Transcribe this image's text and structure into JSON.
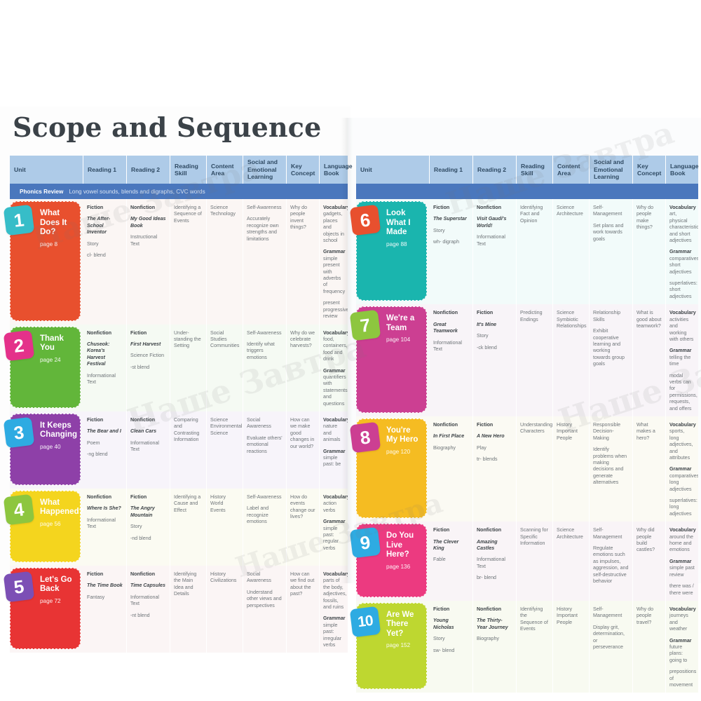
{
  "document": {
    "title": "Scope and Sequence",
    "watermark": "Наше Завтра"
  },
  "table": {
    "columns": [
      "Unit",
      "Reading 1",
      "Reading 2",
      "Reading Skill",
      "Content Area",
      "Social and Emotional Learning",
      "Key Concept",
      "Language Book"
    ],
    "phonics": {
      "label": "Phonics Review",
      "text": "Long vowel sounds, blends and digraphs, CVC words",
      "right_label": "",
      "right_text": ""
    }
  },
  "colors": {
    "header_band": "#aecbe8",
    "phonics_band": "#4a77bd",
    "title_text": "#3b4248"
  },
  "units_left": [
    {
      "number": "1",
      "title": "What Does It Do?",
      "page": "page 8",
      "card_color": "#e8502e",
      "badge_color": "#37bdc8",
      "row_tint": "#fbf6f4",
      "reading1": {
        "type": "Fiction",
        "book": "The After-School Inventor",
        "genre": "Story",
        "phonics": "cl- blend"
      },
      "reading2": {
        "type": "Nonfiction",
        "book": "My Good Ideas Book",
        "genre": "Instructional Text",
        "phonics": ""
      },
      "reading_skill": "Identifying a Sequence of Events",
      "content_area": "Science Technology",
      "sel_title": "Self-Awareness",
      "sel_text": "Accurately recognize own strengths and limitations",
      "key_concept": "Why do people invent things?",
      "vocab_label": "Vocabulary",
      "vocab_text": "gadgets, places and objects in school",
      "grammar_label": "Grammar",
      "grammar_text": "simple present with adverbs of frequency",
      "grammar_extra": "present progressive review"
    },
    {
      "number": "2",
      "title": "Thank You",
      "page": "page 24",
      "card_color": "#62b63a",
      "badge_color": "#e4318a",
      "row_tint": "#f5faf3",
      "reading1": {
        "type": "Nonfiction",
        "book": "Chuseok: Korea's Harvest Festival",
        "genre": "Informational Text",
        "phonics": ""
      },
      "reading2": {
        "type": "Fiction",
        "book": "First Harvest",
        "genre": "Science Fiction",
        "phonics": "-st blend"
      },
      "reading_skill": "Under-standing the Setting",
      "content_area": "Social Studies Communities",
      "sel_title": "Self-Awareness",
      "sel_text": "Identify what triggers emotions",
      "key_concept": "Why do we celebrate harvests?",
      "vocab_label": "Vocabulary",
      "vocab_text": "food, containers, food and drink",
      "grammar_label": "Grammar",
      "grammar_text": "quantifiers with statements and questions",
      "grammar_extra": ""
    },
    {
      "number": "3",
      "title": "It Keeps Changing",
      "page": "page 40",
      "card_color": "#8e40a8",
      "badge_color": "#2eabe2",
      "row_tint": "#f7f4fa",
      "reading1": {
        "type": "Fiction",
        "book": "The Bear and I",
        "genre": "Poem",
        "phonics": "-ng blend"
      },
      "reading2": {
        "type": "Nonfiction",
        "book": "Clean Cars",
        "genre": "Informational Text",
        "phonics": ""
      },
      "reading_skill": "Comparing and Contrasting Information",
      "content_area": "Science Environmental Science",
      "sel_title": "Social Awareness",
      "sel_text": "Evaluate others' emotional reactions",
      "key_concept": "How can we make good changes in our world?",
      "vocab_label": "Vocabulary",
      "vocab_text": "nature and animals",
      "grammar_label": "Grammar",
      "grammar_text": "simple past: be",
      "grammar_extra": ""
    },
    {
      "number": "4",
      "title": "What Happened?",
      "page": "page 56",
      "card_color": "#f4d51e",
      "badge_color": "#8dc63f",
      "row_tint": "#fbfbf2",
      "reading1": {
        "type": "Nonfiction",
        "book": "Where Is She?",
        "genre": "Informational Text",
        "phonics": ""
      },
      "reading2": {
        "type": "Fiction",
        "book": "The Angry Mountain",
        "genre": "Story",
        "phonics": "-nd blend"
      },
      "reading_skill": "Identifying a Cause and Effect",
      "content_area": "History World Events",
      "sel_title": "Self-Awareness",
      "sel_text": "Label and recognize emotions",
      "key_concept": "How do events change our lives?",
      "vocab_label": "Vocabulary",
      "vocab_text": "action verbs",
      "grammar_label": "Grammar",
      "grammar_text": "simple past: regular verbs",
      "grammar_extra": ""
    },
    {
      "number": "5",
      "title": "Let's Go Back",
      "page": "page 72",
      "card_color": "#e83434",
      "badge_color": "#7c4fb5",
      "row_tint": "#fbf5f5",
      "reading1": {
        "type": "Fiction",
        "book": "The Time Book",
        "genre": "Fantasy",
        "phonics": ""
      },
      "reading2": {
        "type": "Nonfiction",
        "book": "Time Capsules",
        "genre": "Informational Text",
        "phonics": "-nt blend"
      },
      "reading_skill": "Identifying the Main Idea and Details",
      "content_area": "History Civilizations",
      "sel_title": "Social Awareness",
      "sel_text": "Understand other views and perspectives",
      "key_concept": "How can we find out about the past?",
      "vocab_label": "Vocabulary",
      "vocab_text": "parts of the body, adjectives, fossils, and ruins",
      "grammar_label": "Grammar",
      "grammar_text": "simple past: irregular verbs",
      "grammar_extra": ""
    }
  ],
  "units_right": [
    {
      "number": "6",
      "title": "Look What I Made",
      "page": "page 88",
      "card_color": "#1ab5ae",
      "badge_color": "#e8502e",
      "row_tint": "#f2fbfa",
      "reading1": {
        "type": "Fiction",
        "book": "The Superstar",
        "genre": "Story",
        "phonics": "wh- digraph"
      },
      "reading2": {
        "type": "Nonfiction",
        "book": "Visit Gaudí's World!",
        "genre": "Informational Text",
        "phonics": ""
      },
      "reading_skill": "Identifying Fact and Opinion",
      "content_area": "Science Architecture",
      "sel_title": "Self-Management",
      "sel_text": "Set plans and work towards goals",
      "key_concept": "Why do people make things?",
      "vocab_label": "Vocabulary",
      "vocab_text": "art, physical characteristics, and short adjectives",
      "grammar_label": "Grammar",
      "grammar_text": "comparatives: short adjectives",
      "grammar_extra": "superlatives: short adjectives"
    },
    {
      "number": "7",
      "title": "We're a Team",
      "page": "page 104",
      "card_color": "#cc3f92",
      "badge_color": "#8dc63f",
      "row_tint": "#f8f4f8",
      "reading1": {
        "type": "Nonfiction",
        "book": "Great Teamwork",
        "genre": "Informational Text",
        "phonics": ""
      },
      "reading2": {
        "type": "Fiction",
        "book": "It's Mine",
        "genre": "Story",
        "phonics": "-ck blend"
      },
      "reading_skill": "Predicting Endings",
      "content_area": "Science Symbiotic Relationships",
      "sel_title": "Relationship Skills",
      "sel_text": "Exhibit cooperative learning and working towards group goals",
      "key_concept": "What is good about teamwork?",
      "vocab_label": "Vocabulary",
      "vocab_text": "activities and working with others",
      "grammar_label": "Grammar",
      "grammar_text": "telling the time",
      "grammar_extra": "modal verbs can for permissions, requests, and offers"
    },
    {
      "number": "8",
      "title": "You're My Hero",
      "page": "page 120",
      "card_color": "#f5bc22",
      "badge_color": "#cc3f92",
      "row_tint": "#fbfaf3",
      "reading1": {
        "type": "Nonfiction",
        "book": "In First Place",
        "genre": "Biography",
        "phonics": ""
      },
      "reading2": {
        "type": "Fiction",
        "book": "A New Hero",
        "genre": "Play",
        "phonics": "tr- blends"
      },
      "reading_skill": "Understanding Characters",
      "content_area": "History Important People",
      "sel_title": "Responsible Decision-Making",
      "sel_text": "Identify problems when making decisions and generate alternatives",
      "key_concept": "What makes a hero?",
      "vocab_label": "Vocabulary",
      "vocab_text": "sports, long adjectives, and attributes",
      "grammar_label": "Grammar",
      "grammar_text": "comparatives: long adjectives",
      "grammar_extra": "superlatives: long adjectives"
    },
    {
      "number": "9",
      "title": "Do You Live Here?",
      "page": "page 136",
      "card_color": "#ec3a80",
      "badge_color": "#2eabe2",
      "row_tint": "#f9f4f7",
      "reading1": {
        "type": "Fiction",
        "book": "The Clever King",
        "genre": "Fable",
        "phonics": ""
      },
      "reading2": {
        "type": "Nonfiction",
        "book": "Amazing Castles",
        "genre": "Informational Text",
        "phonics": "br- blend"
      },
      "reading_skill": "Scanning for Specific Information",
      "content_area": "Science Architecture",
      "sel_title": "Self-Management",
      "sel_text": "Regulate emotions such as impulses, aggression, and self-destructive behavior",
      "key_concept": "Why did people build castles?",
      "vocab_label": "Vocabulary",
      "vocab_text": "around the home and emotions",
      "grammar_label": "Grammar",
      "grammar_text": "simple past review",
      "grammar_extra": "there was / there were"
    },
    {
      "number": "10",
      "title": "Are We There Yet?",
      "page": "page 152",
      "card_color": "#bed730",
      "badge_color": "#2eabe2",
      "row_tint": "#f8faf1",
      "reading1": {
        "type": "Fiction",
        "book": "Young Nicholas",
        "genre": "Story",
        "phonics": "sw- blend"
      },
      "reading2": {
        "type": "Nonfiction",
        "book": "The Thirty-Year Journey",
        "genre": "Biography",
        "phonics": ""
      },
      "reading_skill": "Identifying the Sequence of Events",
      "content_area": "History Important People",
      "sel_title": "Self-Management",
      "sel_text": "Display grit, determination, or perseverance",
      "key_concept": "Why do people travel?",
      "vocab_label": "Vocabulary",
      "vocab_text": "journeys and weather",
      "grammar_label": "Grammar",
      "grammar_text": "future plans: going to",
      "grammar_extra": "prepositions of movement"
    }
  ]
}
